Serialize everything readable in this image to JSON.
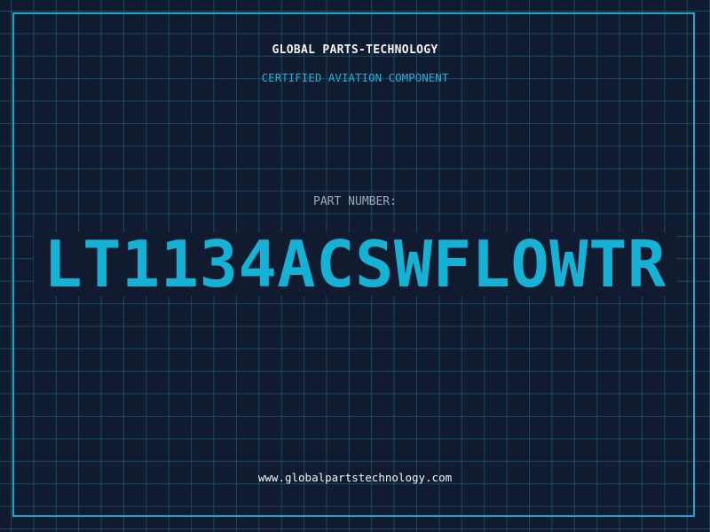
{
  "header": {
    "company": "GLOBAL PARTS-TECHNOLOGY",
    "subtitle": "CERTIFIED AVIATION COMPONENT"
  },
  "part": {
    "label": "PART NUMBER:",
    "number": "LT1134ACSWFLOWTR"
  },
  "footer": {
    "website": "www.globalpartstechnology.com"
  },
  "colors": {
    "background": "#101b30",
    "grid": "#1e6e8c",
    "accent": "#15b2d6",
    "frame": "#1aa6c8",
    "text": "#f2f5f8",
    "muted": "#9aa9bb"
  }
}
